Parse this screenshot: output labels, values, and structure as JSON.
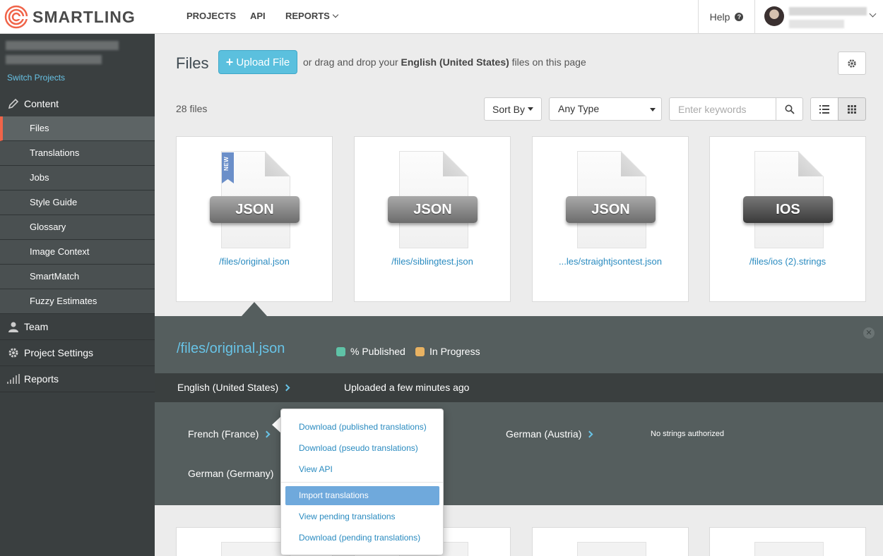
{
  "brand": {
    "name": "SMARTLING"
  },
  "nav": {
    "projects": "PROJECTS",
    "api": "API",
    "reports": "REPORTS"
  },
  "help": {
    "label": "Help"
  },
  "sidebar": {
    "switch_projects": "Switch Projects",
    "content": "Content",
    "items": [
      {
        "label": "Files",
        "active": true
      },
      {
        "label": "Translations"
      },
      {
        "label": "Jobs"
      },
      {
        "label": "Style Guide"
      },
      {
        "label": "Glossary"
      },
      {
        "label": "Image Context"
      },
      {
        "label": "SmartMatch"
      },
      {
        "label": "Fuzzy Estimates"
      }
    ],
    "team": "Team",
    "project_settings": "Project Settings",
    "reports": "Reports"
  },
  "main": {
    "title": "Files",
    "upload_label": "Upload File",
    "drag_prefix": "or drag and drop your",
    "drag_lang": "English (United States)",
    "drag_suffix": "files on this page",
    "count": "28 files",
    "sort_label": "Sort By",
    "type_label": "Any Type",
    "search_placeholder": "Enter keywords"
  },
  "cards": [
    {
      "type": "JSON",
      "name": "/files/original.json",
      "badge": "NEW"
    },
    {
      "type": "JSON",
      "name": "/files/siblingtest.json"
    },
    {
      "type": "JSON",
      "name": "...les/straightjsontest.json"
    },
    {
      "type": "IOS",
      "name": "/files/ios (2).strings"
    }
  ],
  "detail": {
    "title": "/files/original.json",
    "legend_published": "% Published",
    "legend_in_progress": "In Progress",
    "source_lang": "English (United States)",
    "uploaded": "Uploaded a few minutes ago",
    "targets": [
      {
        "label": "French (France)"
      },
      {
        "label": "German (Germany)"
      },
      {
        "label": "German (Austria)",
        "status": "No strings authorized"
      }
    ],
    "colors": {
      "published": "#5fc3a7",
      "in_progress": "#e8b262"
    }
  },
  "menu": {
    "download_published": "Download (published translations)",
    "download_pseudo": "Download (pseudo translations)",
    "view_api": "View API",
    "import": "Import translations",
    "view_pending": "View pending translations",
    "download_pending": "Download (pending translations)"
  },
  "colors": {
    "accent": "#5bc0de",
    "link": "#2a8bc0",
    "sidebar": "#3a3f40",
    "active_marker": "#f06449"
  }
}
